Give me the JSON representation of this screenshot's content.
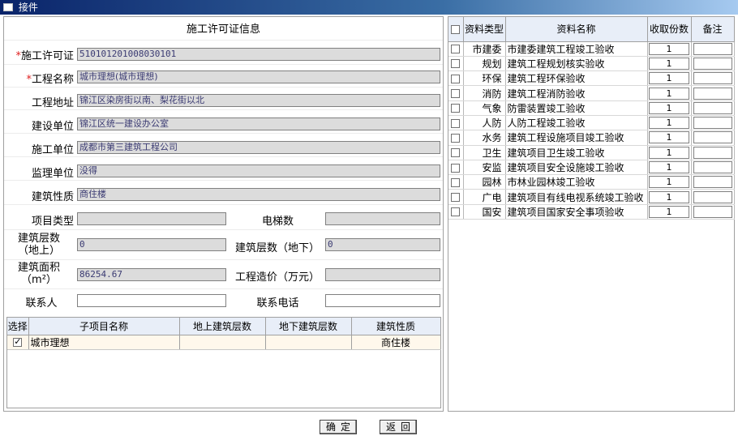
{
  "window": {
    "title": "接件"
  },
  "permit": {
    "title": "施工许可证信息",
    "fields": [
      {
        "label": "施工许可证",
        "required": true,
        "value": "510101201008030101"
      },
      {
        "label": "工程名称",
        "required": true,
        "value": "城市理想(城市理想)"
      },
      {
        "label": "工程地址",
        "required": false,
        "value": "锦江区染房街以南、梨花街以北"
      },
      {
        "label": "建设单位",
        "required": false,
        "value": "锦江区统一建设办公室"
      },
      {
        "label": "施工单位",
        "required": false,
        "value": "成都市第三建筑工程公司"
      },
      {
        "label": "监理单位",
        "required": false,
        "value": "没得"
      },
      {
        "label": "建筑性质",
        "required": false,
        "value": "商住楼"
      }
    ],
    "project_type": {
      "label": "项目类型",
      "value": ""
    },
    "elevators": {
      "label": "电梯数",
      "value": ""
    },
    "floors_above": {
      "label": "建筑层数（地上）",
      "value": "0"
    },
    "floors_below": {
      "label": "建筑层数（地下）",
      "value": "0"
    },
    "area": {
      "label": "建筑面积（m²）",
      "value": "86254.67"
    },
    "cost": {
      "label": "工程造价（万元）",
      "value": ""
    },
    "contact": {
      "label": "联系人",
      "value": ""
    },
    "phone": {
      "label": "联系电话",
      "value": ""
    }
  },
  "subprojects": {
    "columns": [
      "选择",
      "子项目名称",
      "地上建筑层数",
      "地下建筑层数",
      "建筑性质"
    ],
    "rows": [
      {
        "checked": true,
        "name": "城市理想",
        "above": "",
        "below": "",
        "nature": "商住楼"
      }
    ]
  },
  "documents": {
    "columns": [
      "资料类型",
      "资料名称",
      "收取份数",
      "备注"
    ],
    "rows": [
      {
        "type": "市建委",
        "name": "市建委建筑工程竣工验收",
        "count": "1",
        "note": ""
      },
      {
        "type": "规划",
        "name": "建筑工程规划核实验收",
        "count": "1",
        "note": ""
      },
      {
        "type": "环保",
        "name": "建筑工程环保验收",
        "count": "1",
        "note": ""
      },
      {
        "type": "消防",
        "name": "建筑工程消防验收",
        "count": "1",
        "note": ""
      },
      {
        "type": "气象",
        "name": "防雷装置竣工验收",
        "count": "1",
        "note": ""
      },
      {
        "type": "人防",
        "name": "人防工程竣工验收",
        "count": "1",
        "note": ""
      },
      {
        "type": "水务",
        "name": "建筑工程设施项目竣工验收",
        "count": "1",
        "note": ""
      },
      {
        "type": "卫生",
        "name": "建筑项目卫生竣工验收",
        "count": "1",
        "note": ""
      },
      {
        "type": "安监",
        "name": "建筑项目安全设施竣工验收",
        "count": "1",
        "note": ""
      },
      {
        "type": "园林",
        "name": "市林业园林竣工验收",
        "count": "1",
        "note": ""
      },
      {
        "type": "广电",
        "name": "建筑项目有线电视系统竣工验收",
        "count": "1",
        "note": ""
      },
      {
        "type": "国安",
        "name": "建筑项目国家安全事项验收",
        "count": "1",
        "note": ""
      }
    ]
  },
  "buttons": {
    "confirm": "确定",
    "back": "返回"
  },
  "colors": {
    "required_mark": "#e02020",
    "header_bg": "#e8eef8",
    "row_highlight": "#fff8ec",
    "titlebar": "#0a246a"
  }
}
